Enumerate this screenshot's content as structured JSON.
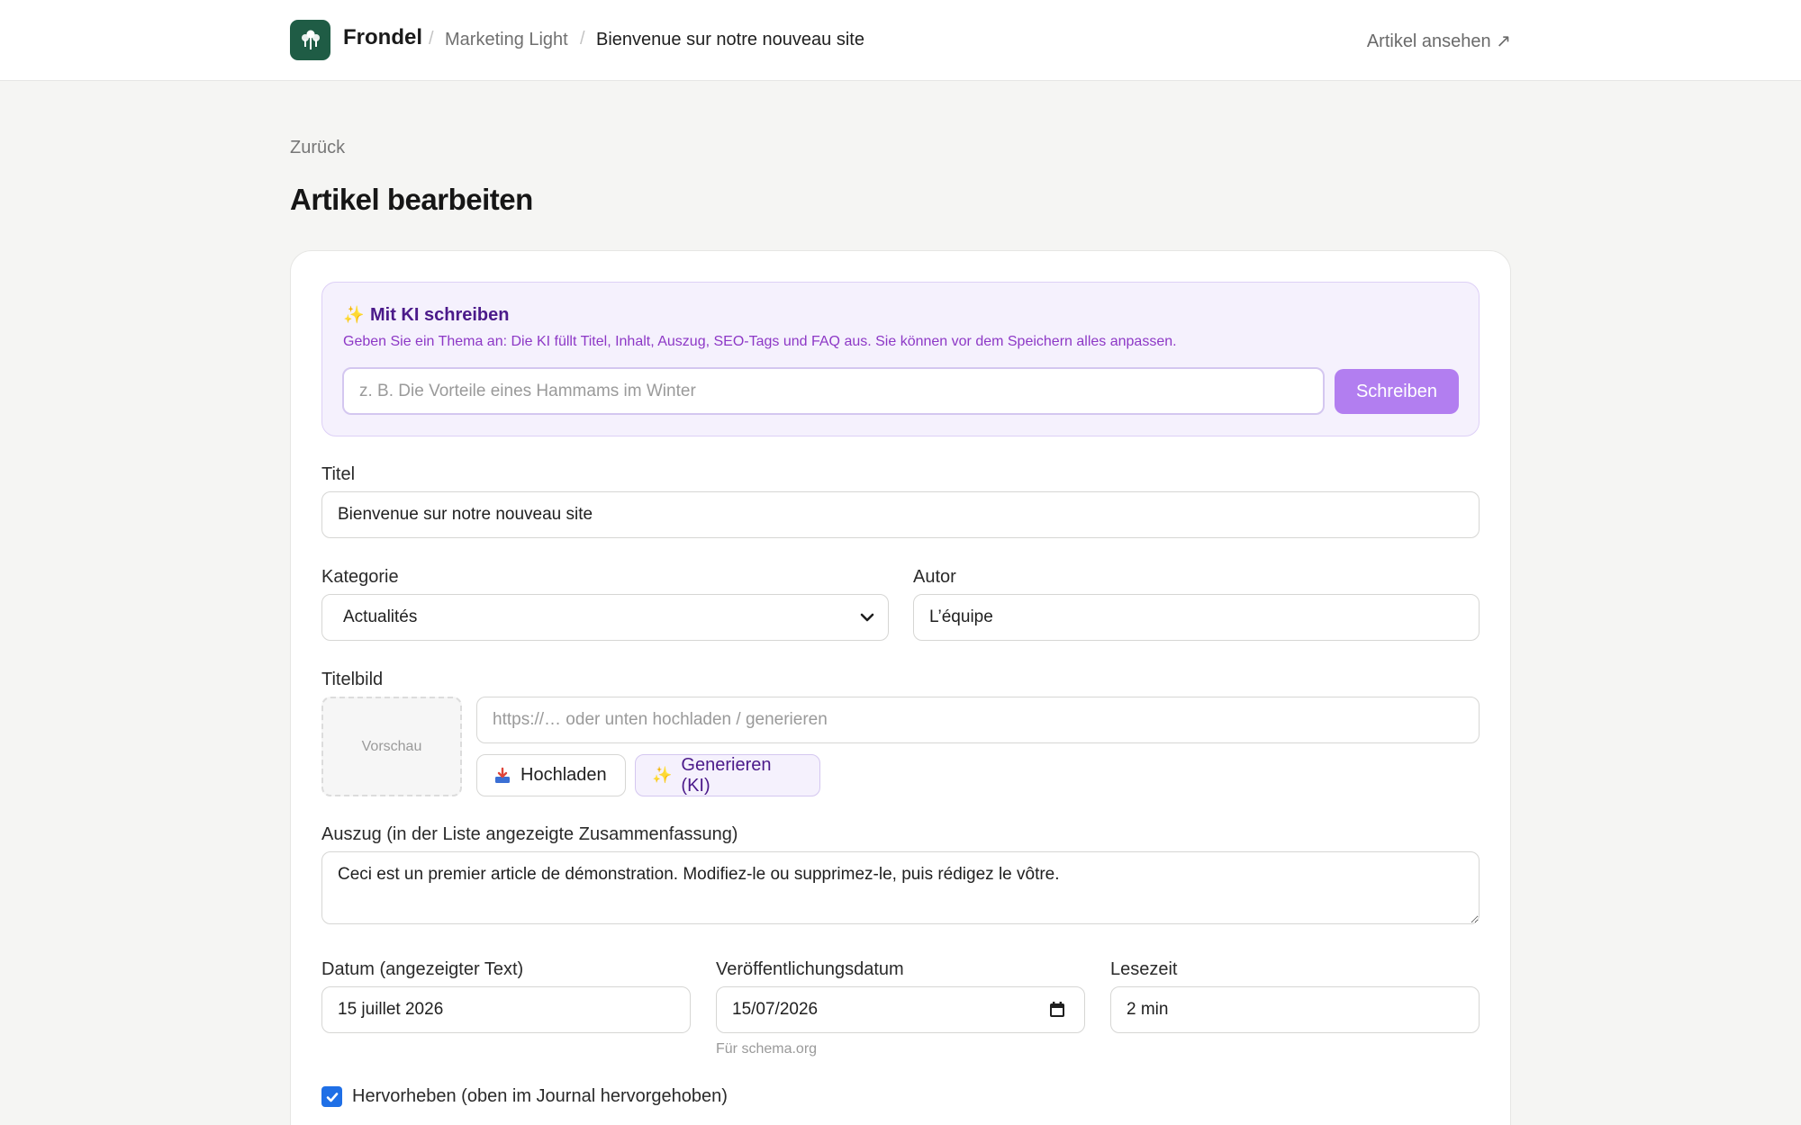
{
  "header": {
    "brand": "Frondel",
    "breadcrumb": [
      "Marketing Light",
      "Bienvenue sur notre nouveau site"
    ],
    "breadcrumb_separator": "/",
    "view_link": "Artikel ansehen ↗"
  },
  "page": {
    "back_label": "Zurück",
    "title": "Artikel bearbeiten"
  },
  "ai": {
    "title": "Mit KI schreiben",
    "description": "Geben Sie ein Thema an: Die KI füllt Titel, Inhalt, Auszug, SEO-Tags und FAQ aus. Sie können vor dem Speichern alles anpassen.",
    "placeholder": "z. B. Die Vorteile eines Hammams im Winter",
    "button": "Schreiben",
    "spark_icon": "✨"
  },
  "form": {
    "title_label": "Titel",
    "title_value": "Bienvenue sur notre nouveau site",
    "category_label": "Kategorie",
    "category_value": "Actualités",
    "author_label": "Autor",
    "author_value": "L’équipe",
    "cover_label": "Titelbild",
    "preview_label": "Vorschau",
    "cover_placeholder": "https://… oder unten hochladen / generieren",
    "upload_button": "Hochladen",
    "generate_button": "Generieren (KI)",
    "excerpt_label": "Auszug (in der Liste angezeigte Zusammenfassung)",
    "excerpt_value": "Ceci est un premier article de démonstration. Modifiez-le ou supprimez-le, puis rédigez le vôtre.",
    "date_label": "Datum (angezeigter Text)",
    "date_value": "15 juillet 2026",
    "publish_label": "Veröffentlichungsdatum",
    "publish_value": "15/07/2026",
    "publish_hint": "Für schema.org",
    "reading_label": "Lesezeit",
    "reading_value": "2 min",
    "featured_label": "Hervorheben (oben im Journal hervorgehoben)",
    "featured_checked": true
  },
  "colors": {
    "brand": "#1f5c45",
    "accent_purple": "#b27ef0",
    "checkbox_blue": "#1f6fe6"
  }
}
